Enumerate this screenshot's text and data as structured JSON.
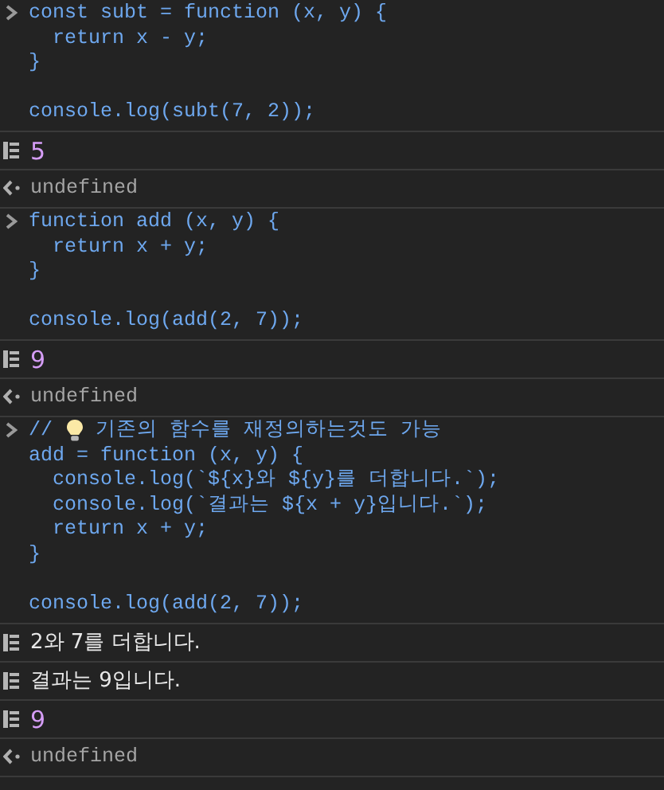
{
  "console": [
    {
      "kind": "input",
      "lines": [
        {
          "kind": "code",
          "text": "const subt = function (x, y) {"
        },
        {
          "kind": "code",
          "text": "  return x - y;"
        },
        {
          "kind": "code",
          "text": "}"
        },
        {
          "kind": "blank"
        },
        {
          "kind": "code",
          "text": "console.log(subt(7, 2));"
        }
      ]
    },
    {
      "kind": "numlog",
      "text": "5"
    },
    {
      "kind": "result",
      "text": "undefined"
    },
    {
      "kind": "input",
      "lines": [
        {
          "kind": "code",
          "text": "function add (x, y) {"
        },
        {
          "kind": "code",
          "text": "  return x + y;"
        },
        {
          "kind": "code",
          "text": "}"
        },
        {
          "kind": "blank"
        },
        {
          "kind": "code",
          "text": "console.log(add(2, 7));"
        }
      ]
    },
    {
      "kind": "numlog",
      "text": "9"
    },
    {
      "kind": "result",
      "text": "undefined"
    },
    {
      "kind": "input",
      "lines": [
        {
          "kind": "bulbcomment",
          "before": "//",
          "after": "기존의 함수를 재정의하는것도 가능"
        },
        {
          "kind": "code",
          "text": "add = function (x, y) {"
        },
        {
          "kind": "code",
          "text": "  console.log(`${x}와 ${y}를 더합니다.`);"
        },
        {
          "kind": "code",
          "text": "  console.log(`결과는 ${x + y}입니다.`);"
        },
        {
          "kind": "code",
          "text": "  return x + y;"
        },
        {
          "kind": "code",
          "text": "}"
        },
        {
          "kind": "blank"
        },
        {
          "kind": "code",
          "text": "console.log(add(2, 7));"
        }
      ]
    },
    {
      "kind": "textlog",
      "text": "2와 7를 더합니다."
    },
    {
      "kind": "textlog",
      "text": "결과는 9입니다."
    },
    {
      "kind": "numlog",
      "text": "9"
    },
    {
      "kind": "result",
      "text": "undefined"
    }
  ]
}
